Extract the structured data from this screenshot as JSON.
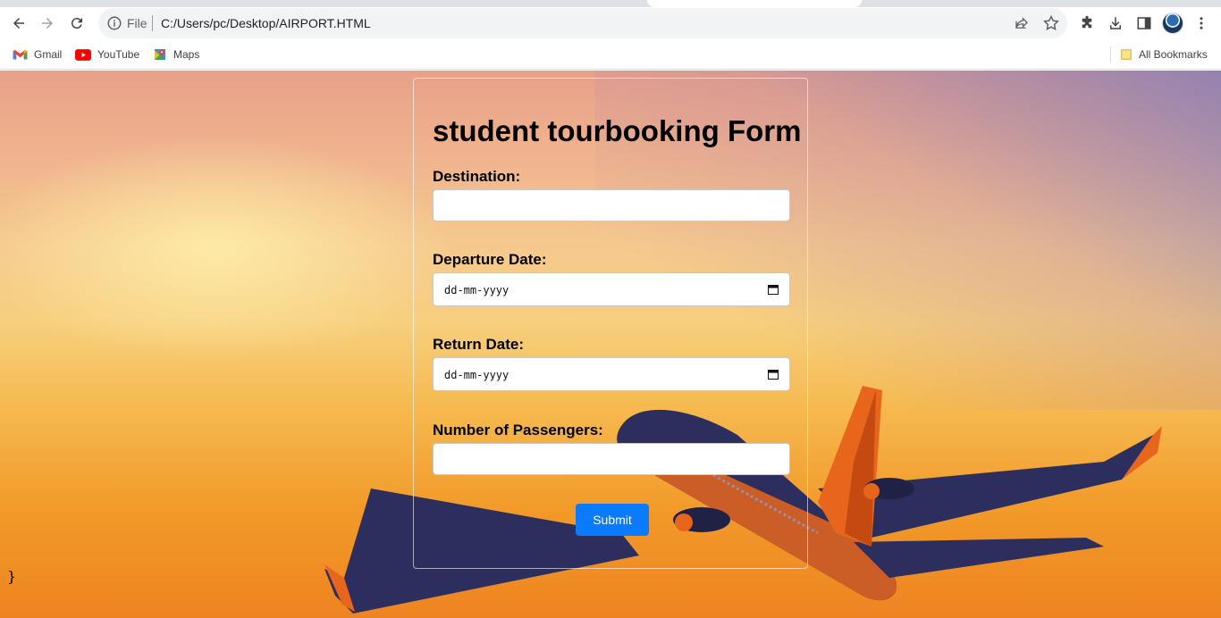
{
  "browser": {
    "url_scheme": "File",
    "url": "C:/Users/pc/Desktop/AIRPORT.HTML",
    "bookmarks": [
      {
        "label": "Gmail",
        "icon": "gmail-icon"
      },
      {
        "label": "YouTube",
        "icon": "youtube-icon"
      },
      {
        "label": "Maps",
        "icon": "maps-icon"
      }
    ],
    "all_bookmarks_label": "All Bookmarks"
  },
  "form": {
    "title": "student tourbooking Form",
    "destination_label": "Destination:",
    "departure_label": "Departure Date:",
    "departure_value": "dd-mm-yyyy",
    "return_label": "Return Date:",
    "return_value": "dd-mm-yyyy",
    "passengers_label": "Number of Passengers:",
    "submit_label": "Submit"
  },
  "page": {
    "stray_text": "}"
  },
  "colors": {
    "submit_button": "#0a7bff",
    "plane_body": "#2c2f5e",
    "plane_tail": "#e8651c"
  }
}
